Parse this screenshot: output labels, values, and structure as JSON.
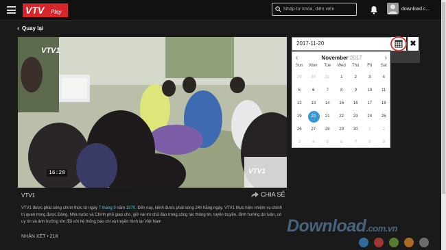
{
  "header": {
    "logo_text": "VTV",
    "logo_sub": "Play",
    "search_placeholder": "Nhập từ khóa, diễn viên",
    "username": "download.c..."
  },
  "nav": {
    "back_label": "Quay lại"
  },
  "video": {
    "channel_logo": "VTV1",
    "timecode": "16:20",
    "title": "VTV1",
    "share_label": "CHIA SẺ",
    "description": {
      "part1": "VTV1 được phát sóng chính thức từ ngày ",
      "date_hl": "7 tháng 9",
      "part2": " năm ",
      "year_hl": "1970",
      "part3": ". Đến nay, kênh được phát sóng 24h hằng ngày. VTV1 thực hiện nhiệm vụ chính trị quan trọng được Đảng, Nhà nước và Chính phủ giao cho, giữ vai trò chủ đạo trong công tác thông tin, tuyên truyền, định hướng dư luận, có uy tín và ảnh hưởng lớn đối với hệ thống báo chí và truyền hình tại Việt Nam"
    },
    "comments_label": "NHẬN XÉT • 218"
  },
  "datepicker": {
    "value": "2017-11-20",
    "month": "November",
    "year": "2017",
    "weekdays": [
      "Sun",
      "Mon",
      "Tue",
      "Wed",
      "Thu",
      "Fri",
      "Sat"
    ],
    "weeks": [
      [
        "29",
        "30",
        "31",
        "1",
        "2",
        "3",
        "4"
      ],
      [
        "5",
        "6",
        "7",
        "8",
        "9",
        "10",
        "11"
      ],
      [
        "12",
        "13",
        "14",
        "15",
        "16",
        "17",
        "18"
      ],
      [
        "19",
        "20",
        "21",
        "22",
        "23",
        "24",
        "25"
      ],
      [
        "26",
        "27",
        "28",
        "29",
        "30",
        "1",
        "2"
      ],
      [
        "3",
        "4",
        "5",
        "6",
        "7",
        "8",
        "9"
      ]
    ],
    "selected": "20",
    "accent": "#3b97d3"
  },
  "watermark": {
    "text": "Download",
    "suffix": ".com.vn"
  },
  "colors": {
    "brand": "#d7262b",
    "highlight": "#5fc0d8",
    "ring": "#d23a3a"
  }
}
